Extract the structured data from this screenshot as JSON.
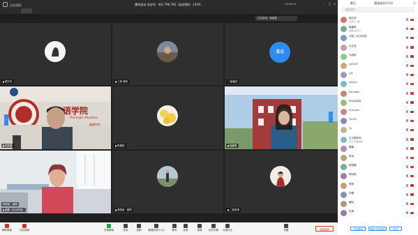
{
  "topbar": {
    "speaker_label": "正在讲话:",
    "meeting_title": "腾讯会议 会议号：441 796 785（会议密码：1019）",
    "clock": "00:43:41",
    "speaking_now": "正在讲话：韩建勇"
  },
  "tiles": {
    "t1_name": "翟红军",
    "t2_name": "三部 黄凯",
    "t3_name": "一部潘成",
    "t3_avatar_text": "潘成",
    "t4_name": "刘志豪",
    "t4_banner": "语学院",
    "t4_banner_sub": "Foreign Studies",
    "t4_banner_chn": "融通中外",
    "t5_name": "陈建雄",
    "t6_name": "韩建勇",
    "t7_name": "谢娜（长沙外语）",
    "t8_name": "胥丽英 · 副院",
    "t9_name": "二部张琪"
  },
  "panel": {
    "title": "管理成员(110)",
    "search_placeholder": "搜索成员",
    "members": [
      {
        "name": "翟红军",
        "sub": "(主持人, 我)"
      },
      {
        "name": "韩建勇",
        "sub": "(联席主持人)"
      },
      {
        "name": "马丽（长沙外语）",
        "sub": ""
      },
      {
        "name": "冯正斌",
        "sub": ""
      },
      {
        "name": "刘淑婷",
        "sub": ""
      },
      {
        "name": "ye2019",
        "sub": ""
      },
      {
        "name": "Lily",
        "sub": ""
      },
      {
        "name": "meilyn",
        "sub": ""
      },
      {
        "name": "Rainbow",
        "sub": ""
      },
      {
        "name": "RONA冉冉",
        "sub": ""
      },
      {
        "name": "Xueyuan",
        "sub": ""
      },
      {
        "name": "Y2023",
        "sub": ""
      },
      {
        "name": "Yu",
        "sub": ""
      },
      {
        "name": "王文慧老师",
        "sub": "(长沙外语学院)"
      },
      {
        "name": "曹娜",
        "sub": ""
      },
      {
        "name": "陈琛",
        "sub": ""
      },
      {
        "name": "陈丽娜",
        "sub": ""
      },
      {
        "name": "陈晓燕",
        "sub": ""
      },
      {
        "name": "陈丽",
        "sub": ""
      },
      {
        "name": "邓璐",
        "sub": ""
      },
      {
        "name": "董晓",
        "sub": ""
      },
      {
        "name": "杜娟",
        "sub": ""
      }
    ],
    "btn_mute_all": "全体静音",
    "btn_unmute_all": "解除全体静音",
    "btn_more": "更多"
  },
  "toolbar": {
    "mic": "解除静音",
    "cam": "开启视频",
    "share": "共享屏幕",
    "security": "安全",
    "record": "录制",
    "members": "管理成员(110)",
    "chat": "聊天",
    "apps": "应用",
    "react": "表情",
    "subtitle": "实时字幕",
    "translate": "分组讨论",
    "settings": "设置",
    "end": "结束会议"
  }
}
